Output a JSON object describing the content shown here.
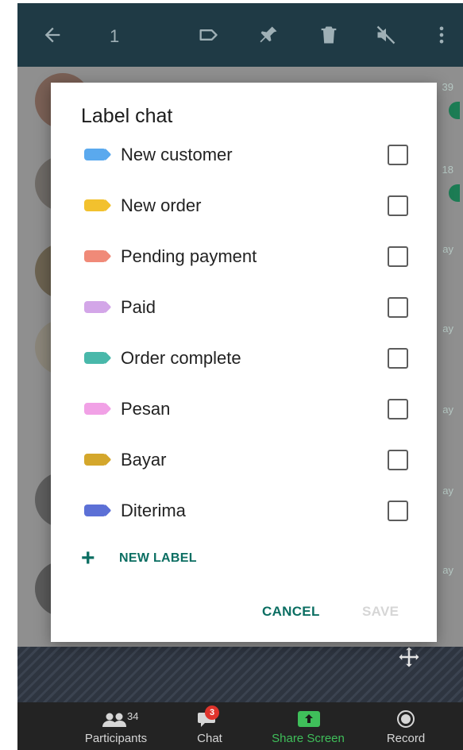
{
  "header": {
    "selected_count": "1",
    "icons": [
      "back-arrow-icon",
      "label-icon",
      "pin-icon",
      "delete-icon",
      "mute-icon",
      "more-vert-icon"
    ]
  },
  "dialog": {
    "title": "Label chat",
    "labels": [
      {
        "name": "New customer",
        "color": "#5aa9ee",
        "checked": false
      },
      {
        "name": "New order",
        "color": "#f2c12e",
        "checked": false
      },
      {
        "name": "Pending payment",
        "color": "#f08a78",
        "checked": false
      },
      {
        "name": "Paid",
        "color": "#d3a6e8",
        "checked": false
      },
      {
        "name": "Order complete",
        "color": "#49b8aa",
        "checked": false
      },
      {
        "name": "Pesan",
        "color": "#f1a1e6",
        "checked": false
      },
      {
        "name": "Bayar",
        "color": "#d4a72c",
        "checked": false
      },
      {
        "name": "Diterima",
        "color": "#5c70d6",
        "checked": false
      }
    ],
    "new_label": "NEW LABEL",
    "cancel": "CANCEL",
    "save": "SAVE"
  },
  "background": {
    "right_fragments": [
      "39",
      "18",
      "ay",
      "ay",
      "ay",
      "ay",
      "ay"
    ]
  },
  "zoom_bar": {
    "participants_label": "Participants",
    "participants_count": "34",
    "chat_label": "Chat",
    "chat_badge": "3",
    "share_label": "Share Screen",
    "record_label": "Record",
    "accent": "#3fbf5a"
  }
}
